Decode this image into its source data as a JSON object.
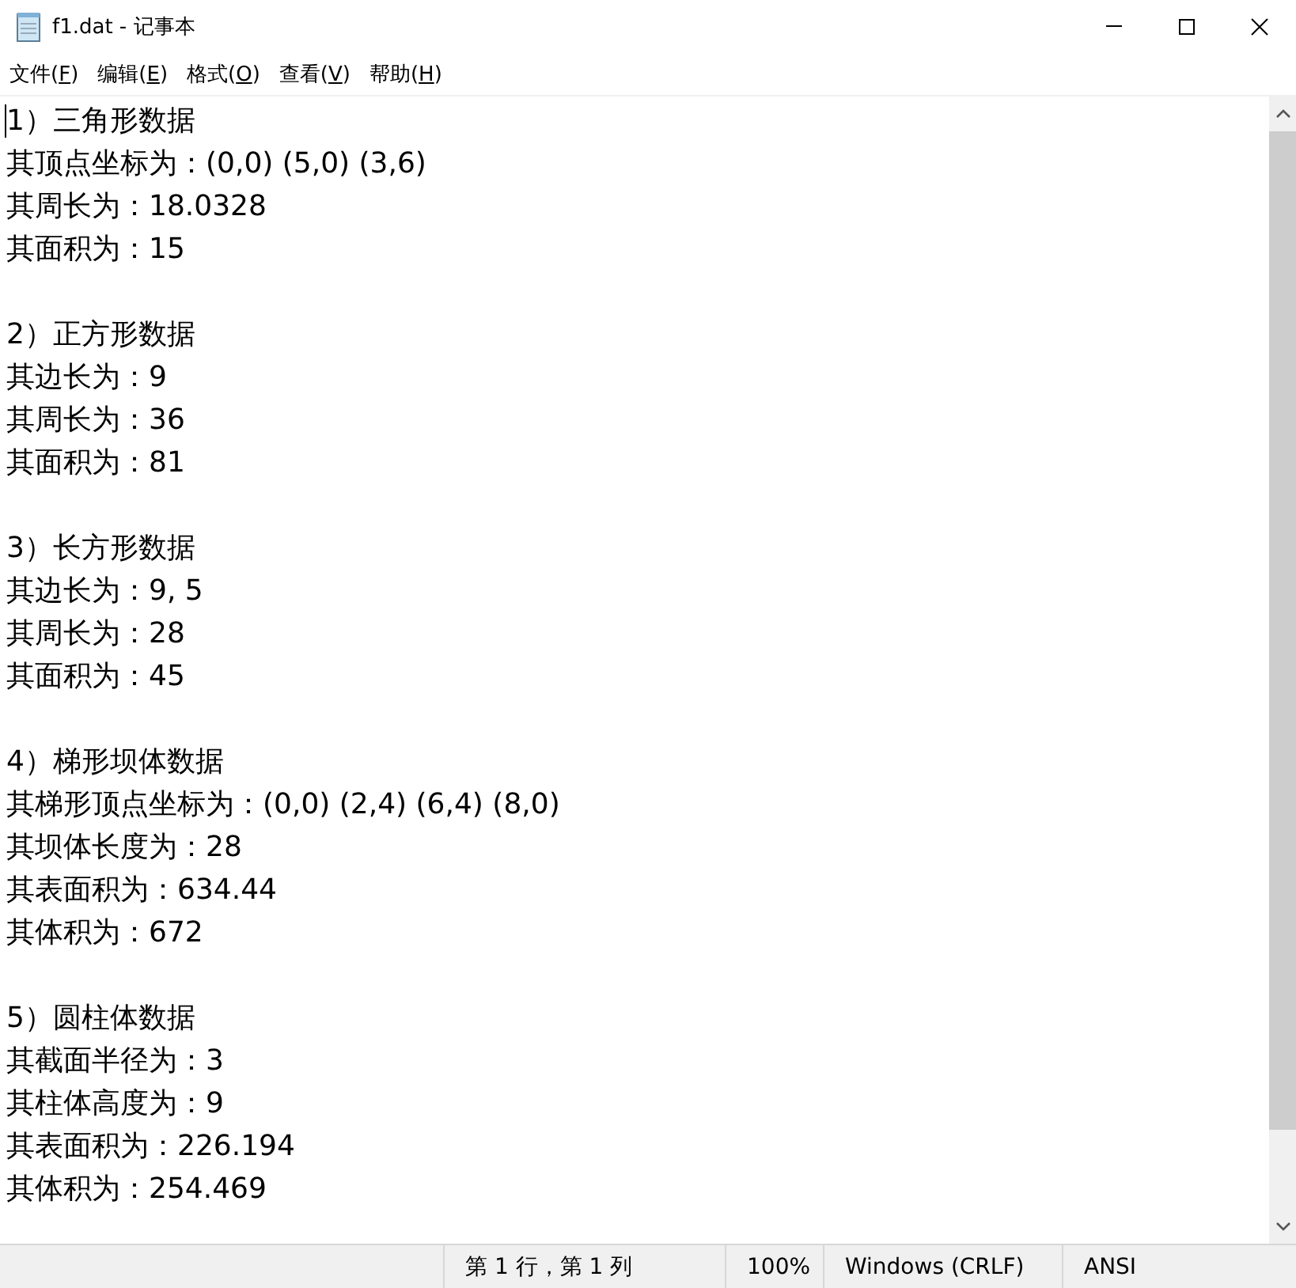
{
  "window": {
    "title": "f1.dat - 记事本"
  },
  "menu": [
    {
      "label": "文件(F)"
    },
    {
      "label": "编辑(E)"
    },
    {
      "label": "格式(O)"
    },
    {
      "label": "查看(V)"
    },
    {
      "label": "帮助(H)"
    }
  ],
  "document": [
    {
      "lines": [
        "1）三角形数据",
        "其顶点坐标为：(0,0) (5,0) (3,6)",
        "其周长为：18.0328",
        "其面积为：15"
      ]
    },
    {
      "lines": [
        "2）正方形数据",
        "其边长为：9",
        "其周长为：36",
        "其面积为：81"
      ]
    },
    {
      "lines": [
        "3）长方形数据",
        "其边长为：9, 5",
        "其周长为：28",
        "其面积为：45"
      ]
    },
    {
      "lines": [
        "4）梯形坝体数据",
        "其梯形顶点坐标为：(0,0) (2,4) (6,4) (8,0)",
        "其坝体长度为：28",
        "其表面积为：634.44",
        "其体积为：672"
      ]
    },
    {
      "lines": [
        "5）圆柱体数据",
        "其截面半径为：3",
        "其柱体高度为：9",
        "其表面积为：226.194",
        "其体积为：254.469"
      ]
    }
  ],
  "status_bar": {
    "position": "第 1 行，第 1 列",
    "zoom": "100%",
    "line_ending": "Windows (CRLF)",
    "encoding": "ANSI"
  }
}
